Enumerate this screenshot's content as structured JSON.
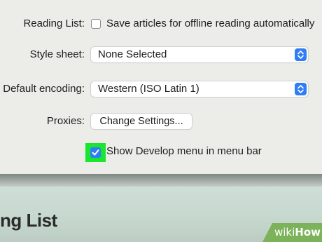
{
  "preferences": {
    "reading_list": {
      "label": "Reading List:",
      "checkbox_label": "Save articles for offline reading automatically",
      "checked": false
    },
    "style_sheet": {
      "label": "Style sheet:",
      "value": "None Selected"
    },
    "default_encoding": {
      "label": "Default encoding:",
      "value": "Western (ISO Latin 1)"
    },
    "proxies": {
      "label": "Proxies:",
      "button_label": "Change Settings..."
    },
    "develop_menu": {
      "checkbox_label": "Show Develop menu in menu bar",
      "checked": true
    }
  },
  "background_page": {
    "heading": "ng List"
  },
  "watermark": {
    "prefix": "wiki",
    "suffix": "How"
  },
  "colors": {
    "accent": "#2f7df6",
    "highlight": "#19e62e",
    "brand": "#7bb25a"
  },
  "icons": {
    "stepper": "chevron-up-down-icon",
    "check": "checkmark-icon"
  }
}
